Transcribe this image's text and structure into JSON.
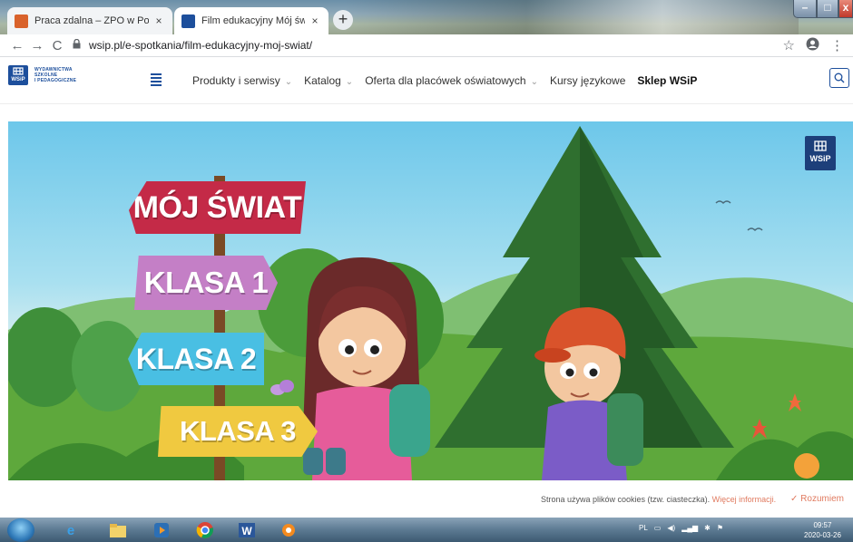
{
  "browser": {
    "tabs": [
      {
        "title": "Praca zdalna – ZPO w Podedwórz",
        "close": "×",
        "favicon_color": "#d9622b"
      },
      {
        "title": "Film edukacyjny Mój świat » Wyd",
        "close": "×",
        "favicon_color": "#1d4f9c"
      }
    ],
    "new_tab": "+",
    "url": "wsip.pl/e-spotkania/film-edukacyjny-moj-swiat/",
    "back": "←",
    "forward": "→",
    "reload": "C",
    "lock": "🔒",
    "star": "☆",
    "profile": "●",
    "menu": "⋮",
    "window": {
      "minimize": "–",
      "maximize": "□",
      "close": "x"
    }
  },
  "site": {
    "logo_mark": "WSiP",
    "logo_lines": [
      "WYDAWNICTWA",
      "SZKOLNE",
      "I PEDAGOGICZNE"
    ],
    "nav": [
      {
        "label": "Produkty i serwisy",
        "chevron": "⌄"
      },
      {
        "label": "Katalog",
        "chevron": "⌄"
      },
      {
        "label": "Oferta dla placówek oświatowych",
        "chevron": "⌄"
      },
      {
        "label": "Kursy językowe",
        "chevron": ""
      },
      {
        "label": "Sklep WSiP",
        "chevron": ""
      }
    ],
    "search_icon": "⚲"
  },
  "hero": {
    "signs": [
      "MÓJ ŚWIAT",
      "KLASA 1",
      "KLASA 2",
      "KLASA 3"
    ],
    "corner_logo": "WSiP"
  },
  "cookie": {
    "message": "Strona używa plików cookies (tzw. ciasteczka).",
    "link": "Więcej informacji.",
    "accept": "Rozumiem",
    "accept_icon": "✓"
  },
  "taskbar": {
    "language": "PL",
    "time": "09:57",
    "date": "2020-03-26"
  }
}
